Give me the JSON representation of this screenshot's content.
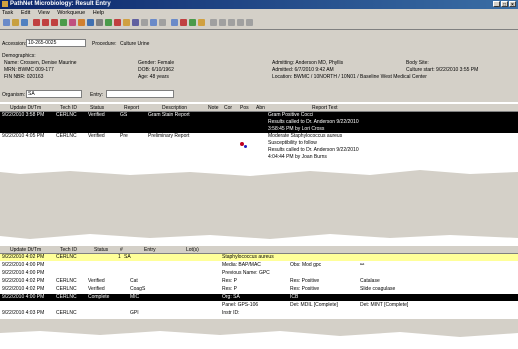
{
  "title": "PathNet Microbiology: Result Entry",
  "menu": [
    "Task",
    "Edit",
    "View",
    "Workqueue",
    "Help"
  ],
  "accession": {
    "label": "Accession:",
    "value": "10-265-0025"
  },
  "procedure": {
    "label": "Procedure:",
    "value": "Culture Urine"
  },
  "demographics": {
    "heading": "Demographics:",
    "name": "Name: Crossen, Denise Maurine",
    "mrn": "MRN: BWMC 009-177",
    "fin": "FIN NBR: 020163",
    "gender": "Gender: Female",
    "dob": "DOB: 6/10/1962",
    "age": "Age: 48 years",
    "admitting": "Admitting: Anderson MD, Phyllis",
    "admitted": "Admitted: 6/7/2010 9:42 AM",
    "location": "Location: BWMC / 10NORTH / 10N01 / Baseline West Medical Center",
    "body_site": "Body Site:",
    "culture_start": "Culture start: 9/22/2010 3:55 PM"
  },
  "organism": {
    "label": "Organism:",
    "value": "SA"
  },
  "entry": {
    "label": "Entry:",
    "value": ""
  },
  "reports_headers": [
    "Update Dt/Tm",
    "Tech ID",
    "Status",
    "Report",
    "Description",
    "Note",
    "Cor",
    "Pos",
    "Abn",
    "Report Text"
  ],
  "reports": [
    {
      "dt": "9/22/2010 3:58 PM",
      "tech": "CERLNC",
      "status": "Verified",
      "report": "GS",
      "desc": "Gram Stain Report",
      "text": [
        "Gram Positive Cocci",
        "Results called to Dr. Anderson  9/22/2010",
        "3:58:45 PM by Lori Cross"
      ]
    },
    {
      "dt": "9/22/2010 4:05 PM",
      "tech": "CERLNC",
      "status": "Verified",
      "report": "Pre",
      "desc": "Preliminary Report",
      "text": [
        "Moderate Staphylococcus aureus",
        "Susceptibility to follow",
        "Results called to Dr. Anderson  9/22/2010",
        "4:04:44 PM by Joan Burns"
      ]
    }
  ],
  "orders_headers": [
    "Update Dt/Tm",
    "Tech ID",
    "Status",
    "#",
    "Entry",
    "Lot(s)"
  ],
  "orders": [
    {
      "dt": "9/22/2010 4:02 PM",
      "tech": "CERLNC",
      "status": "",
      "num": "1",
      "entry": "SA",
      "detail1": "Staphylococcus aureus",
      "detail2": "",
      "detail3": ""
    },
    {
      "dt": "9/22/2010 4:00 PM",
      "tech": "",
      "status": "",
      "num": "",
      "entry": "",
      "detail1": "Media:  BAP/MAC",
      "detail2": "Obs:  Mod gpc",
      "detail3": ""
    },
    {
      "dt": "9/22/2010 4:00 PM",
      "tech": "",
      "status": "",
      "num": "",
      "entry": "",
      "detail1": "Previous Name:  GPC",
      "detail2": "",
      "detail3": ""
    },
    {
      "dt": "9/22/2010 4:02 PM",
      "tech": "CERLNC",
      "status": "Verified",
      "num": "",
      "entry": "Cat",
      "detail1": "Res:  P",
      "detail2": "Res:  Positive",
      "detail3": "Catalase"
    },
    {
      "dt": "9/22/2010 4:02 PM",
      "tech": "CERLNC",
      "status": "Verified",
      "num": "",
      "entry": "CoagS",
      "detail1": "Res:  P",
      "detail2": "Res:  Positive",
      "detail3": "Slide coagulase"
    },
    {
      "dt": "9/22/2010 4:00 PM",
      "tech": "CERLNC",
      "status": "Complete",
      "num": "",
      "entry": "MIC",
      "detail1": "Org:  SA",
      "detail2": "ICB",
      "detail3": ""
    },
    {
      "dt": "",
      "tech": "",
      "status": "",
      "num": "",
      "entry": "",
      "detail1": "Panel:  GPS-106",
      "detail2": "Det:  MDIL [Complete]",
      "detail3": "Det:  MINT [Complete]"
    },
    {
      "dt": "9/22/2010 4:03 PM",
      "tech": "CERLNC",
      "status": "",
      "num": "",
      "entry": "GPI",
      "detail1": "Instr ID:",
      "detail2": "",
      "detail3": ""
    }
  ],
  "colors": {
    "title": "#0a246a",
    "selected": "#000000",
    "highlight": "#ffff99",
    "chrome": "#d4d0c8"
  }
}
